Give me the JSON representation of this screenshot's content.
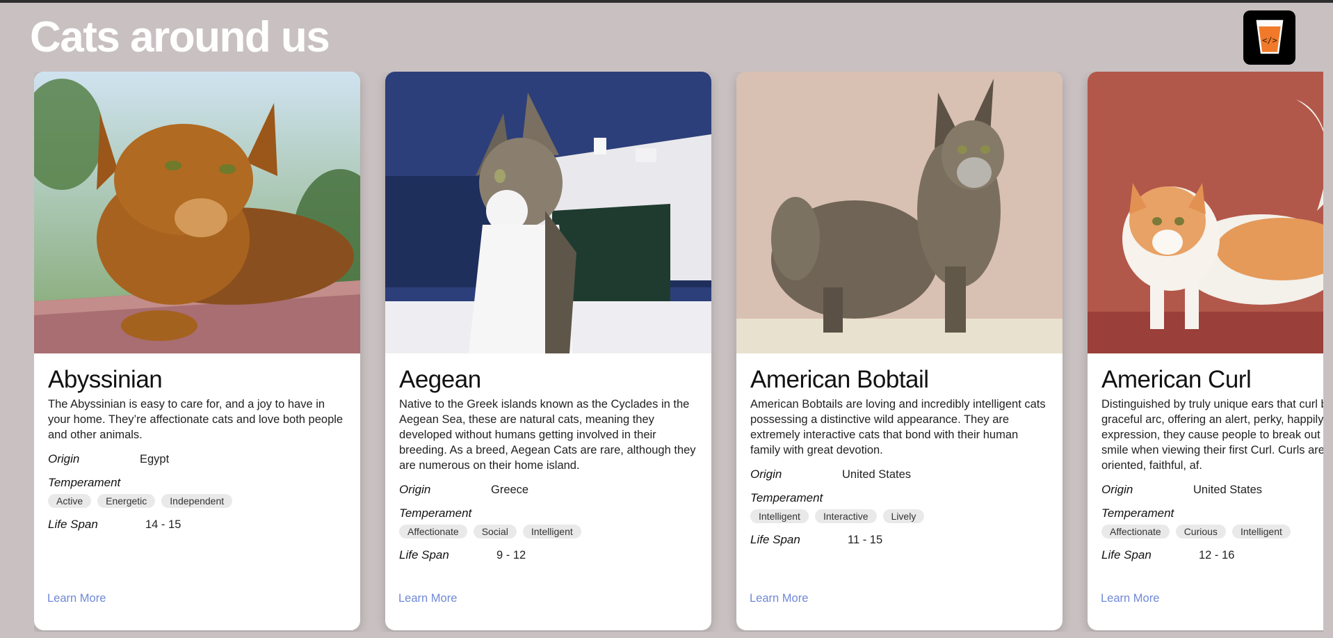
{
  "page": {
    "title": "Cats around us"
  },
  "cards": [
    {
      "name": "Abyssinian",
      "description": "The Abyssinian is easy to care for, and a joy to have in your home. They’re affectionate cats and love both people and other animals.",
      "origin_label": "Origin",
      "origin": "Egypt",
      "temperament_label": "Temperament",
      "temperament": [
        "Active",
        "Energetic",
        "Independent"
      ],
      "lifespan_label": "Life Span",
      "lifespan": "14 - 15",
      "learn_more": "Learn More"
    },
    {
      "name": "Aegean",
      "description": "Native to the Greek islands known as the Cyclades in the Aegean Sea, these are natural cats, meaning they developed without humans getting involved in their breeding. As a breed, Aegean Cats are rare, although they are numerous on their home island.",
      "origin_label": "Origin",
      "origin": "Greece",
      "temperament_label": "Temperament",
      "temperament": [
        "Affectionate",
        "Social",
        "Intelligent"
      ],
      "lifespan_label": "Life Span",
      "lifespan": "9 - 12",
      "learn_more": "Learn More"
    },
    {
      "name": "American Bobtail",
      "description": "American Bobtails are loving and incredibly intelligent cats possessing a distinctive wild appearance. They are extremely interactive cats that bond with their human family with great devotion.",
      "origin_label": "Origin",
      "origin": "United States",
      "temperament_label": "Temperament",
      "temperament": [
        "Intelligent",
        "Interactive",
        "Lively"
      ],
      "lifespan_label": "Life Span",
      "lifespan": "11 - 15",
      "learn_more": "Learn More"
    },
    {
      "name": "American Curl",
      "description": "Distinguished by truly unique ears that curl back in a graceful arc, offering an alert, perky, happily surprised expression, they cause people to break out into a silly smile when viewing their first Curl. Curls are very people-oriented, faithful, af.",
      "origin_label": "Origin",
      "origin": "United States",
      "temperament_label": "Temperament",
      "temperament": [
        "Affectionate",
        "Curious",
        "Intelligent"
      ],
      "lifespan_label": "Life Span",
      "lifespan": "12 - 16",
      "learn_more": "Learn More"
    }
  ],
  "logo": {
    "icon": "code-glass-icon",
    "accent": "#f07a2a"
  },
  "colors": {
    "background": "#c9c1c1",
    "link": "#6f88d6",
    "chip": "#e9e9e9"
  }
}
